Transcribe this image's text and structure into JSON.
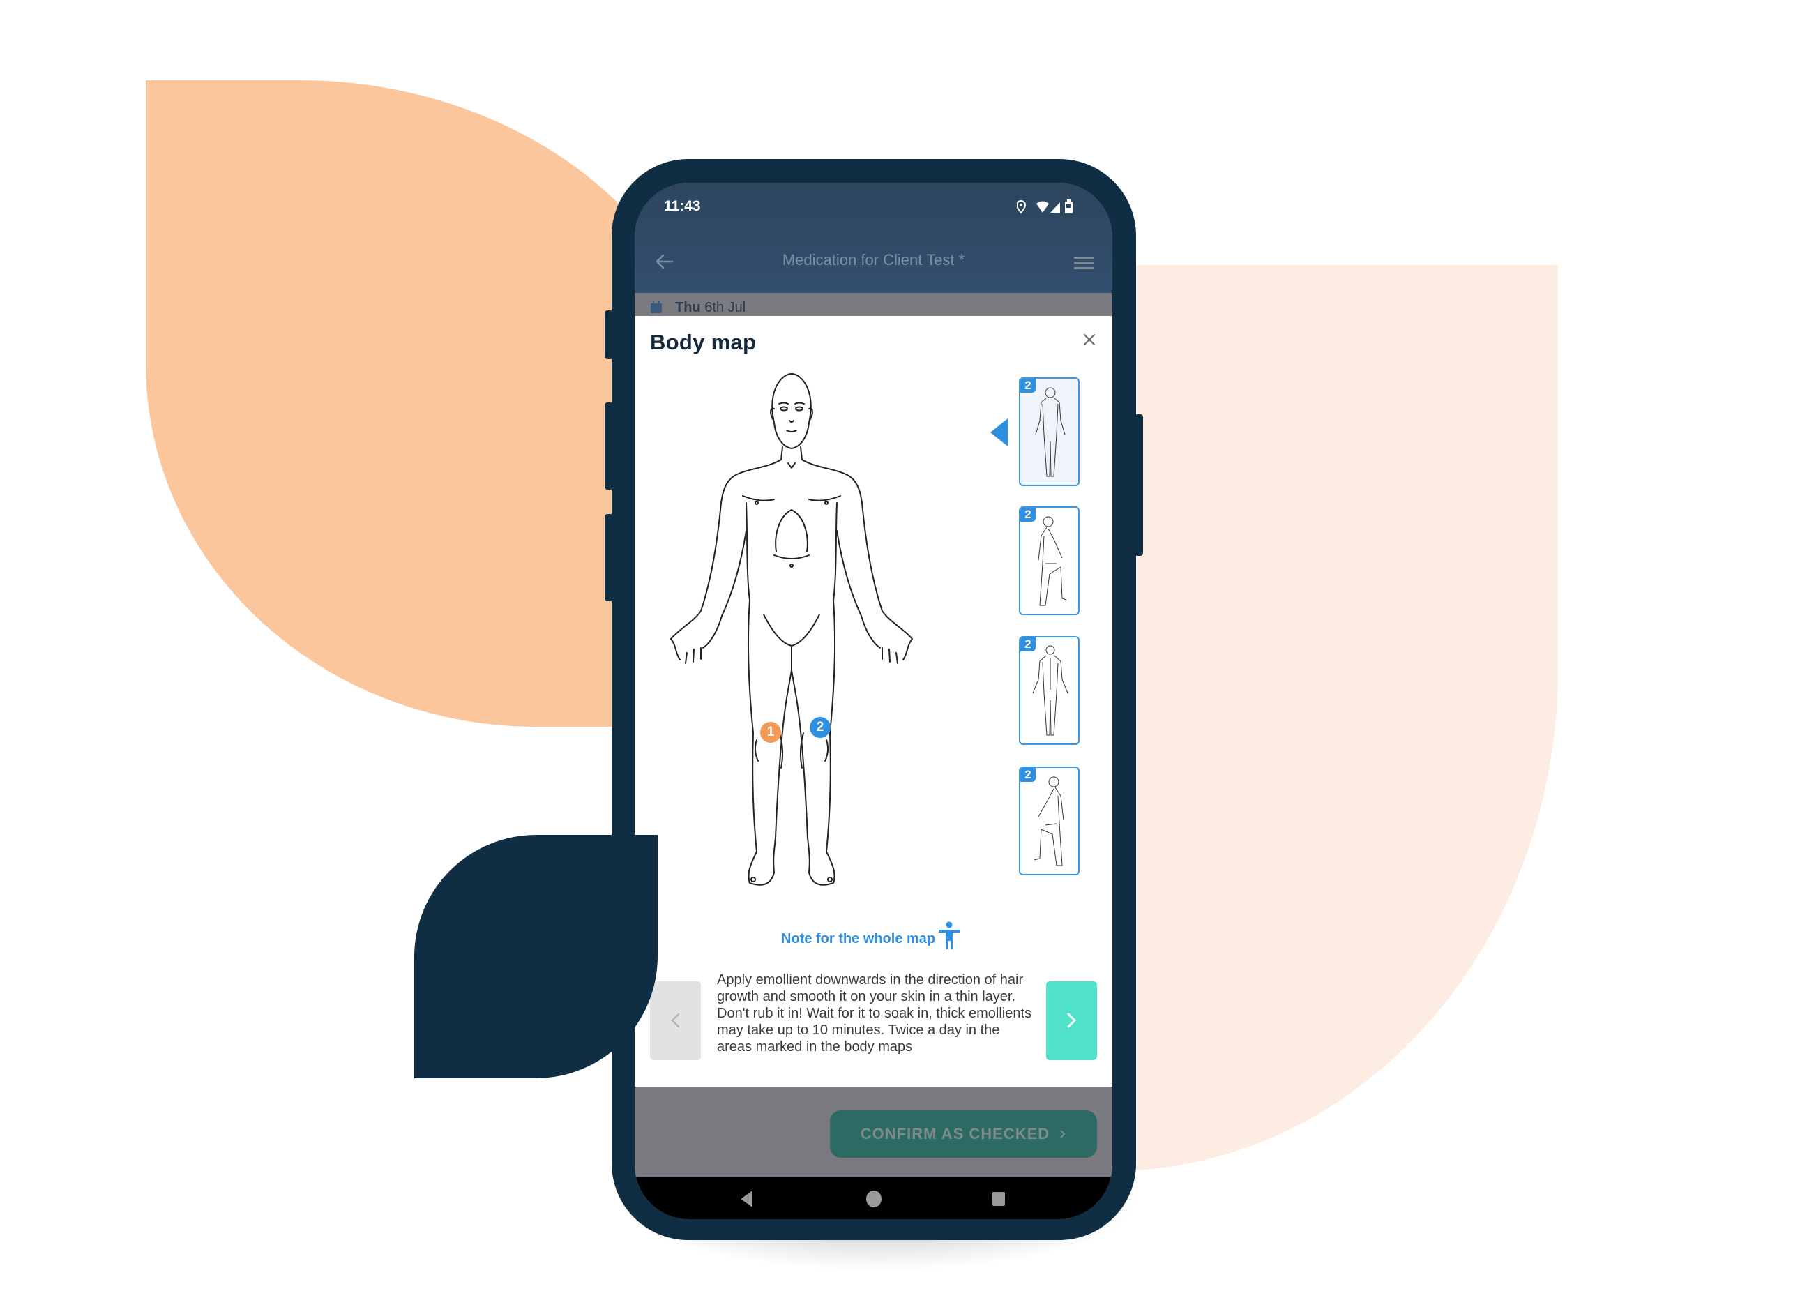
{
  "status_bar": {
    "time": "11:43",
    "icons": [
      "location-icon",
      "wifi-icon",
      "signal-icon",
      "battery-icon"
    ]
  },
  "app_bar": {
    "title": "Medication for Client Test *",
    "back_icon": "arrow-left-icon",
    "menu_icon": "hamburger-menu-icon"
  },
  "date_row": {
    "day": "Thu",
    "date": "6th Jul",
    "icon": "calendar-icon"
  },
  "modal": {
    "title": "Body map",
    "close_icon": "close-icon",
    "markers": [
      {
        "label": "1",
        "color": "#f39a55",
        "location": "right knee"
      },
      {
        "label": "2",
        "color": "#2f8fe0",
        "location": "left knee"
      }
    ],
    "thumbnails": [
      {
        "view": "front",
        "count": "2",
        "selected": true
      },
      {
        "view": "side-left",
        "count": "2",
        "selected": false
      },
      {
        "view": "back",
        "count": "2",
        "selected": false
      },
      {
        "view": "side-right",
        "count": "2",
        "selected": false
      }
    ],
    "note_label": "Note for the whole map",
    "note_icon": "accessibility-person-icon",
    "note_text": "Apply emollient downwards in the direction of hair growth and smooth it on your skin in a thin layer. Don't rub it in! Wait for it to soak in, thick emollients may take up to 10 minutes. Twice a day in the areas marked in the body maps",
    "prev_icon": "chevron-left-icon",
    "next_icon": "chevron-right-icon"
  },
  "footer": {
    "confirm_label": "CONFIRM AS CHECKED",
    "confirm_icon": "chevron-right-icon"
  },
  "nav_bar": {
    "icons": [
      "back-triangle-icon",
      "home-circle-icon",
      "recents-square-icon"
    ]
  },
  "colors": {
    "accent_blue": "#2f8fe0",
    "marker_orange": "#f39a55",
    "teal": "#4fe2c8",
    "phone_frame": "#0f2e44",
    "bg_orange": "#fcc69d",
    "bg_peach": "#fdece1"
  }
}
